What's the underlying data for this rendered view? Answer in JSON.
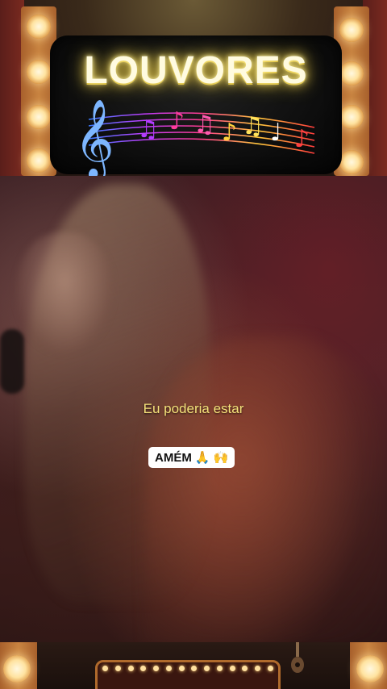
{
  "banner": {
    "title": "LOUVORES"
  },
  "video": {
    "subtitle": "Eu poderia estar"
  },
  "reaction": {
    "label": "AMÉM",
    "emojis": "🙏 🙌"
  },
  "icons": [
    "treble-clef-icon",
    "music-notes-icon",
    "guitar-icon",
    "marquee-lights-icon"
  ],
  "colors": {
    "title_glow": "#ffe45c",
    "subtitle": "#f5e27a",
    "bulb_frame": "#c88340"
  }
}
